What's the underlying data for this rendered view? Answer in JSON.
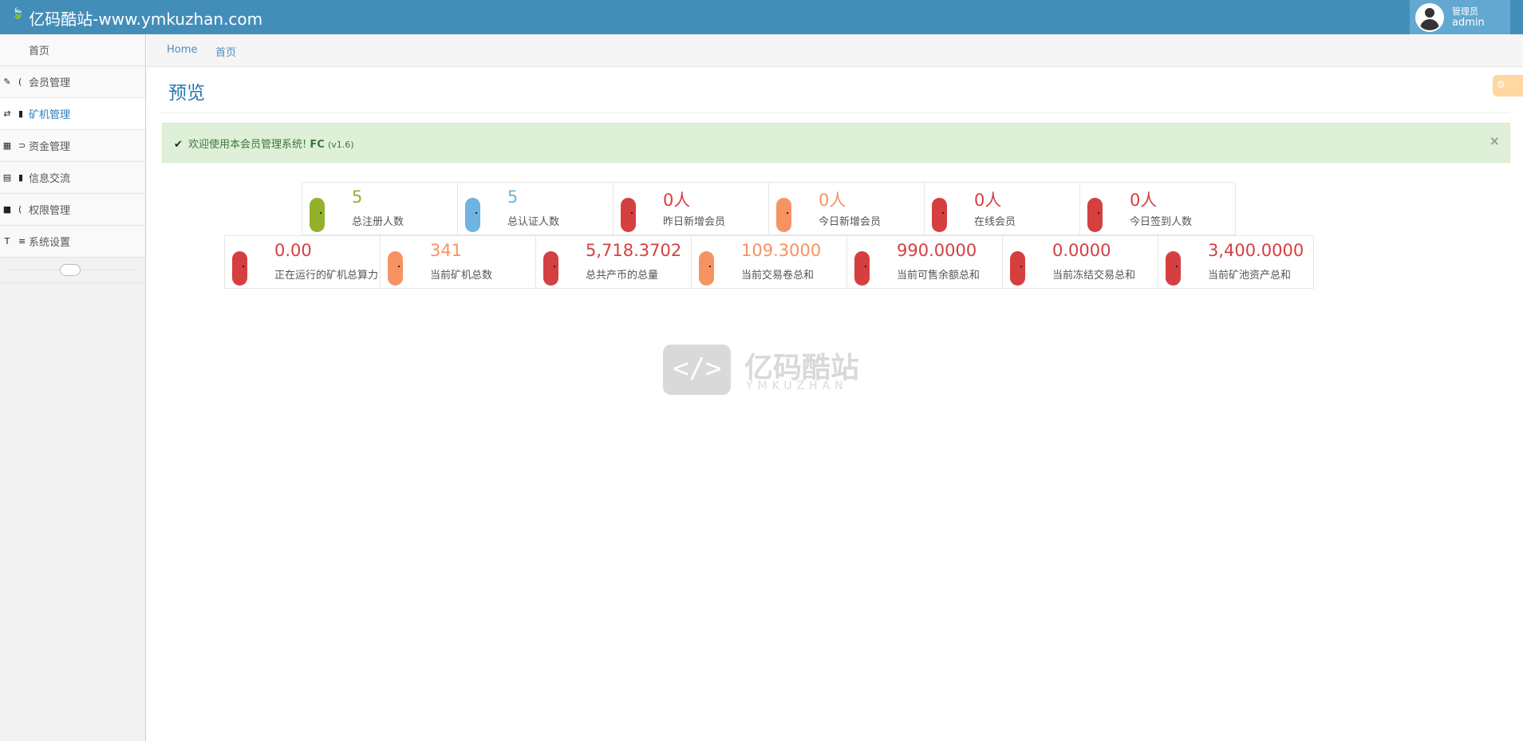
{
  "header": {
    "brand_title": "亿码酷站-www.ymkuzhan.com",
    "brand_icon": "leaf-icon",
    "user_role": "管理员",
    "user_name": "admin"
  },
  "sidebar": {
    "home_label": "首页",
    "items": [
      {
        "label": "会员管理",
        "icon": "pencil-square-icon"
      },
      {
        "label": "矿机管理",
        "icon": "shuffle-icon"
      },
      {
        "label": "资金管理",
        "icon": "calendar-icon"
      },
      {
        "label": "信息交流",
        "icon": "list-alt-icon"
      },
      {
        "label": "权限管理",
        "icon": "file-icon"
      },
      {
        "label": "系统设置",
        "icon": "text-height-icon"
      }
    ],
    "active_item": "矿机管理"
  },
  "breadcrumbs": [
    "Home",
    "首页"
  ],
  "page": {
    "title": "预览",
    "settings_icon": "gear-icon"
  },
  "alert": {
    "prefix": "欢迎使用本会员管理系统!",
    "product": "FC",
    "version": "(v1.6)",
    "close_label": "×"
  },
  "stats_row1": [
    {
      "value": "5",
      "label": "总注册人数",
      "color": "#94b12c"
    },
    {
      "value": "5",
      "label": "总认证人数",
      "color": "#6fb3e0"
    },
    {
      "value": "0人",
      "label": "昨日新增会员",
      "color": "#d53f40"
    },
    {
      "value": "0人",
      "label": "今日新增会员",
      "color": "#f79263"
    },
    {
      "value": "0人",
      "label": "在线会员",
      "color": "#d53f40"
    },
    {
      "value": "0人",
      "label": "今日签到人数",
      "color": "#d53f40"
    }
  ],
  "stats_row2": [
    {
      "value": "0.00",
      "label": "正在运行的矿机总算力",
      "color": "#d53f40"
    },
    {
      "value": "341",
      "label": "当前矿机总数",
      "color": "#f79263"
    },
    {
      "value": "5,718.3702",
      "label": "总共产币的总量",
      "color": "#d53f40"
    },
    {
      "value": "109.3000",
      "label": "当前交易卷总和",
      "color": "#f79263"
    },
    {
      "value": "990.0000",
      "label": "当前可售余额总和",
      "color": "#d53f40"
    },
    {
      "value": "0.0000",
      "label": "当前冻结交易总和",
      "color": "#d53f40"
    },
    {
      "value": "3,400.0000",
      "label": "当前矿池资产总和",
      "color": "#d53f40"
    }
  ],
  "watermark": {
    "symbol": "</>",
    "name_cn": "亿码酷站",
    "name_en": "YMKUZHAN"
  }
}
